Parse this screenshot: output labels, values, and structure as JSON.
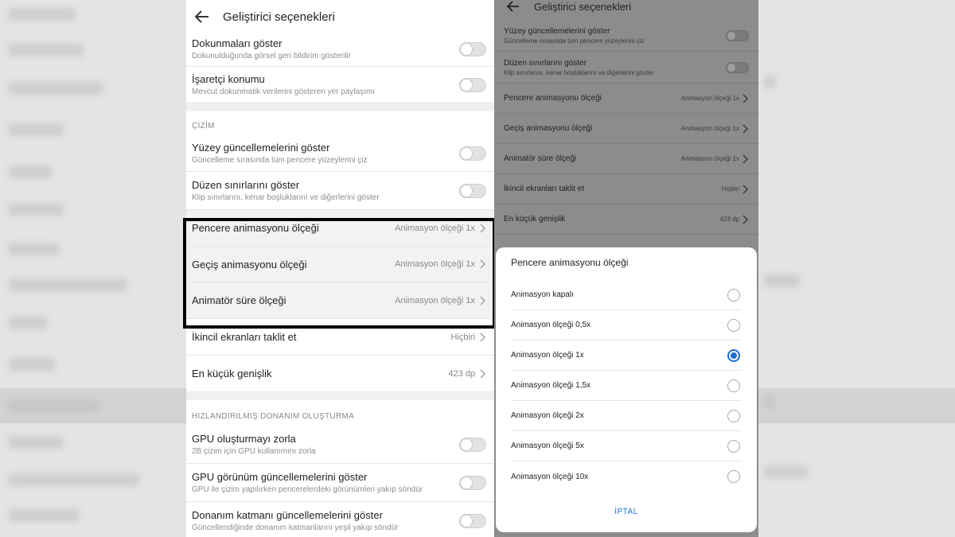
{
  "left": {
    "title": "Geliştirici seçenekleri",
    "rows_top": [
      {
        "title": "Dokunmaları göster",
        "subtitle": "Dokunulduğunda görsel geri bildirim gösterilir"
      },
      {
        "title": "İşaretçi konumu",
        "subtitle": "Mevcut dokunmatik verilerini gösteren yer paylaşımı"
      }
    ],
    "section_drawing": "ÇİZİM",
    "rows_drawing": [
      {
        "title": "Yüzey güncellemelerini göster",
        "subtitle": "Güncelleme sırasında tüm pencere yüzeylerini çiz"
      },
      {
        "title": "Düzen sınırlarını göster",
        "subtitle": "Klip sınırlarını, kenar boşluklarını ve diğerlerini göster"
      }
    ],
    "rows_anim": [
      {
        "title": "Pencere animasyonu ölçeği",
        "value": "Animasyon ölçeği 1x"
      },
      {
        "title": "Geçiş animasyonu ölçeği",
        "value": "Animasyon ölçeği 1x"
      },
      {
        "title": "Animatör süre ölçeği",
        "value": "Animasyon ölçeği 1x"
      }
    ],
    "rows_value": [
      {
        "title": "İkincil ekranları taklit et",
        "value": "Hiçbiri"
      },
      {
        "title": "En küçük genişlik",
        "value": "423 dp"
      }
    ],
    "section_hw": "HIZLANDIRILMIŞ DONANIM OLUŞTURMA",
    "rows_hw": [
      {
        "title": "GPU oluşturmayı zorla",
        "subtitle": "2B çizim için GPU kullanımını zorla"
      },
      {
        "title": "GPU görünüm güncellemelerini göster",
        "subtitle": "GPU ile çizim yapılırken pencerelerdeki görünümleri yakıp söndür"
      },
      {
        "title": "Donanım katmanı güncellemelerini göster",
        "subtitle": "Güncellendiğinde donanım katmanlarını yeşil yakıp söndür"
      }
    ]
  },
  "right": {
    "title": "Geliştirici seçenekleri",
    "rows_toggle": [
      {
        "title": "Yüzey güncellemelerini göster",
        "subtitle": "Güncelleme sırasında tüm pencere yüzeylerini çiz"
      },
      {
        "title": "Düzen sınırlarını göster",
        "subtitle": "Klip sınırlarını, kenar boşluklarını ve diğerlerini göster"
      }
    ],
    "rows_value": [
      {
        "title": "Pencere animasyonu ölçeği",
        "value": "Animasyon ölçeği 1x"
      },
      {
        "title": "Geçiş animasyonu ölçeği",
        "value": "Animasyon ölçeği 1x"
      },
      {
        "title": "Animatör süre ölçeği",
        "value": "Animasyon ölçeği 1x"
      },
      {
        "title": "İkincil ekranları taklit et",
        "value": "Hiçbiri"
      },
      {
        "title": "En küçük genişlik",
        "value": "423 dp"
      }
    ],
    "dialog": {
      "title": "Pencere animasyonu ölçeği",
      "options": [
        "Animasyon kapalı",
        "Animasyon ölçeği 0,5x",
        "Animasyon ölçeği 1x",
        "Animasyon ölçeği 1,5x",
        "Animasyon ölçeği 2x",
        "Animasyon ölçeği 5x",
        "Animasyon ölçeği 10x"
      ],
      "selected": "Animasyon ölçeği 1x",
      "cancel": "İPTAL"
    }
  },
  "colors": {
    "accent": "#1f6fd6",
    "highlight_border": "#000000"
  }
}
